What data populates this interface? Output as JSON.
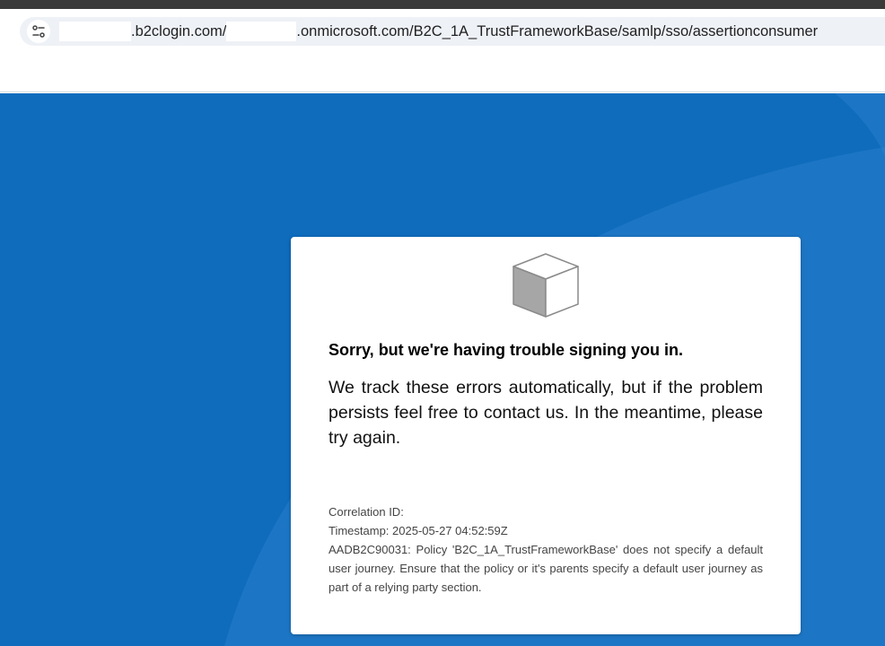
{
  "browser": {
    "url_part_1": ".b2clogin.com/",
    "url_part_2": ".onmicrosoft.com/B2C_1A_TrustFrameworkBase/samlp/sso/assertionconsumer",
    "site_info_icon": "tune-icon"
  },
  "error_card": {
    "icon": "cube-icon",
    "heading": "Sorry, but we're having trouble signing you in.",
    "message": "We track these errors automatically, but if the problem persists feel free to contact us. In the meantime, please try again.",
    "correlation_id": "Correlation ID:",
    "timestamp": "Timestamp: 2025-05-27 04:52:59Z",
    "error_detail": "AADB2C90031: Policy 'B2C_1A_TrustFrameworkBase' does not specify a default user journey. Ensure that the policy or it's parents specify a default user journey as part of a relying party section."
  },
  "colors": {
    "background_blue": "#0f6cbd",
    "card_white": "#ffffff",
    "omnibox_bg": "#eef1f6"
  }
}
